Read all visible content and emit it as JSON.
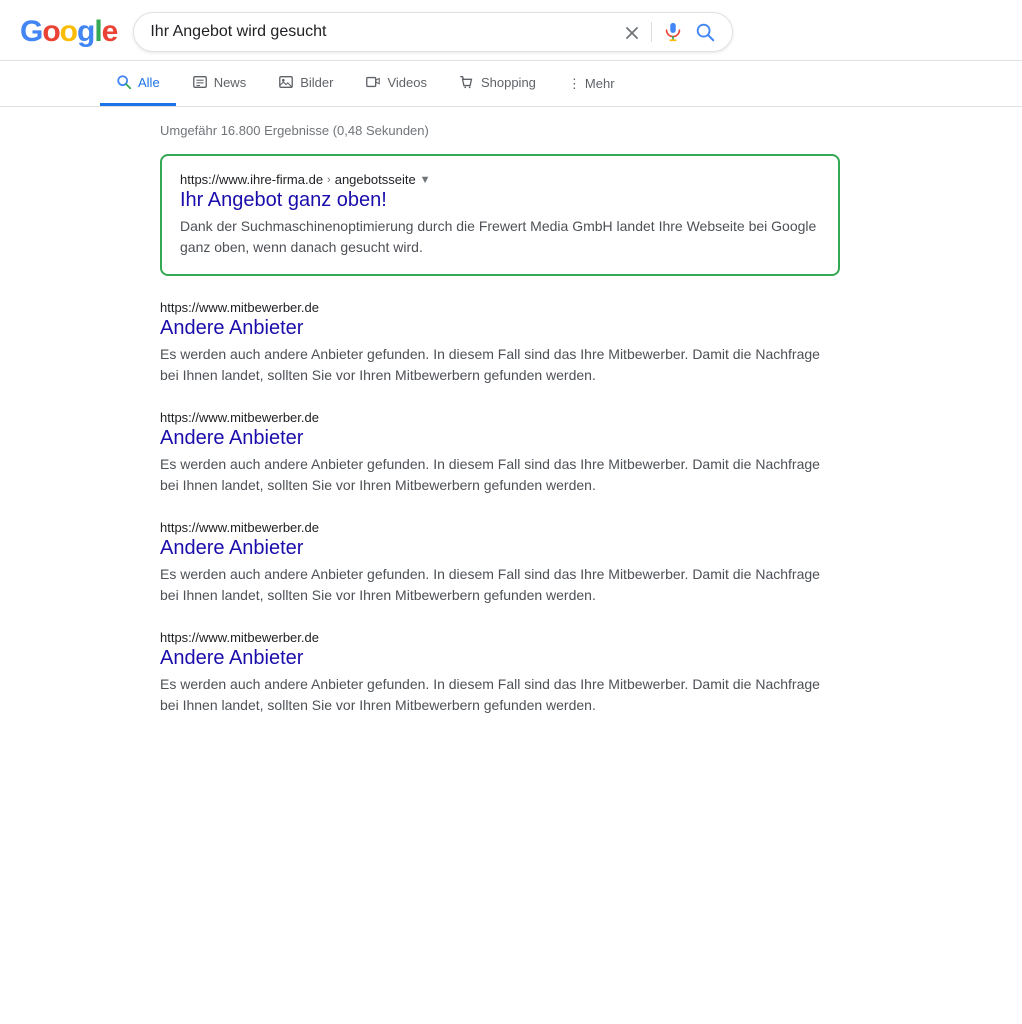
{
  "header": {
    "logo_letters": [
      {
        "letter": "G",
        "color": "g-blue"
      },
      {
        "letter": "o",
        "color": "g-red"
      },
      {
        "letter": "o",
        "color": "g-yellow"
      },
      {
        "letter": "g",
        "color": "g-blue"
      },
      {
        "letter": "l",
        "color": "g-green"
      },
      {
        "letter": "e",
        "color": "g-red"
      }
    ],
    "search_query": "Ihr Angebot wird gesucht",
    "clear_label": "×"
  },
  "nav": {
    "tabs": [
      {
        "id": "alle",
        "label": "Alle",
        "active": true
      },
      {
        "id": "news",
        "label": "News",
        "active": false
      },
      {
        "id": "bilder",
        "label": "Bilder",
        "active": false
      },
      {
        "id": "videos",
        "label": "Videos",
        "active": false
      },
      {
        "id": "shopping",
        "label": "Shopping",
        "active": false
      }
    ],
    "more_label": "Mehr"
  },
  "results": {
    "stats": "Umgefähr 16.800 Ergebnisse (0,48 Sekunden)",
    "featured": {
      "url": "https://www.ihre-firma.de",
      "url_path": "angebotsseite",
      "title": "Ihr Angebot ganz oben!",
      "snippet": "Dank der Suchmaschinenoptimierung durch die Frewert Media GmbH landet Ihre Webseite bei Google ganz oben, wenn danach gesucht wird."
    },
    "items": [
      {
        "url": "https://www.mitbewerber.de",
        "title": "Andere Anbieter",
        "snippet": "Es werden auch andere Anbieter gefunden. In diesem Fall sind das Ihre Mitbewerber. Damit die Nachfrage bei Ihnen landet, sollten Sie vor Ihren Mitbewerbern gefunden werden."
      },
      {
        "url": "https://www.mitbewerber.de",
        "title": "Andere Anbieter",
        "snippet": "Es werden auch andere Anbieter gefunden. In diesem Fall sind das Ihre Mitbewerber. Damit die Nachfrage bei Ihnen landet, sollten Sie vor Ihren Mitbewerbern gefunden werden."
      },
      {
        "url": "https://www.mitbewerber.de",
        "title": "Andere Anbieter",
        "snippet": "Es werden auch andere Anbieter gefunden. In diesem Fall sind das Ihre Mitbewerber. Damit die Nachfrage bei Ihnen landet, sollten Sie vor Ihren Mitbewerbern gefunden werden."
      },
      {
        "url": "https://www.mitbewerber.de",
        "title": "Andere Anbieter",
        "snippet": "Es werden auch andere Anbieter gefunden. In diesem Fall sind das Ihre Mitbewerber. Damit die Nachfrage bei Ihnen landet, sollten Sie vor Ihren Mitbewerbern gefunden werden."
      }
    ]
  }
}
